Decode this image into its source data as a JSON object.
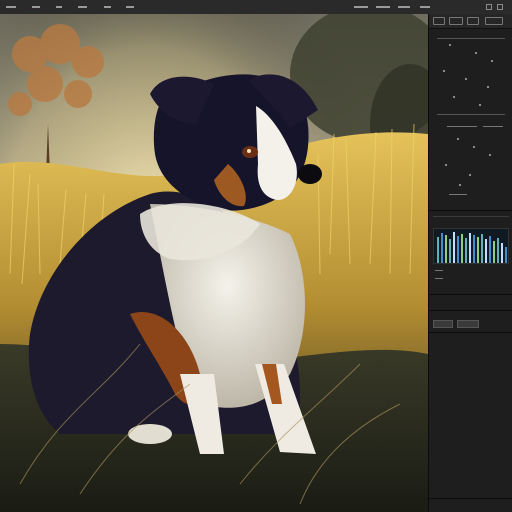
{
  "app": {
    "menubar": {
      "items": 6
    },
    "canvas": {
      "subject": "dog-painting"
    },
    "panel": {
      "tabs": [
        "tab-1",
        "tab-2",
        "tab-3",
        "tab-4"
      ],
      "histogram_colors": [
        "#5fb3b8",
        "#3f8fd0",
        "#8fd07f",
        "#c0e0ff"
      ],
      "buttons": [
        "button-1",
        "button-2"
      ]
    },
    "colors": {
      "bg": "#1c1c1c",
      "panel": "#1e1e1e",
      "grass": "#d6b34a",
      "sky": "#cfc6a6"
    }
  }
}
